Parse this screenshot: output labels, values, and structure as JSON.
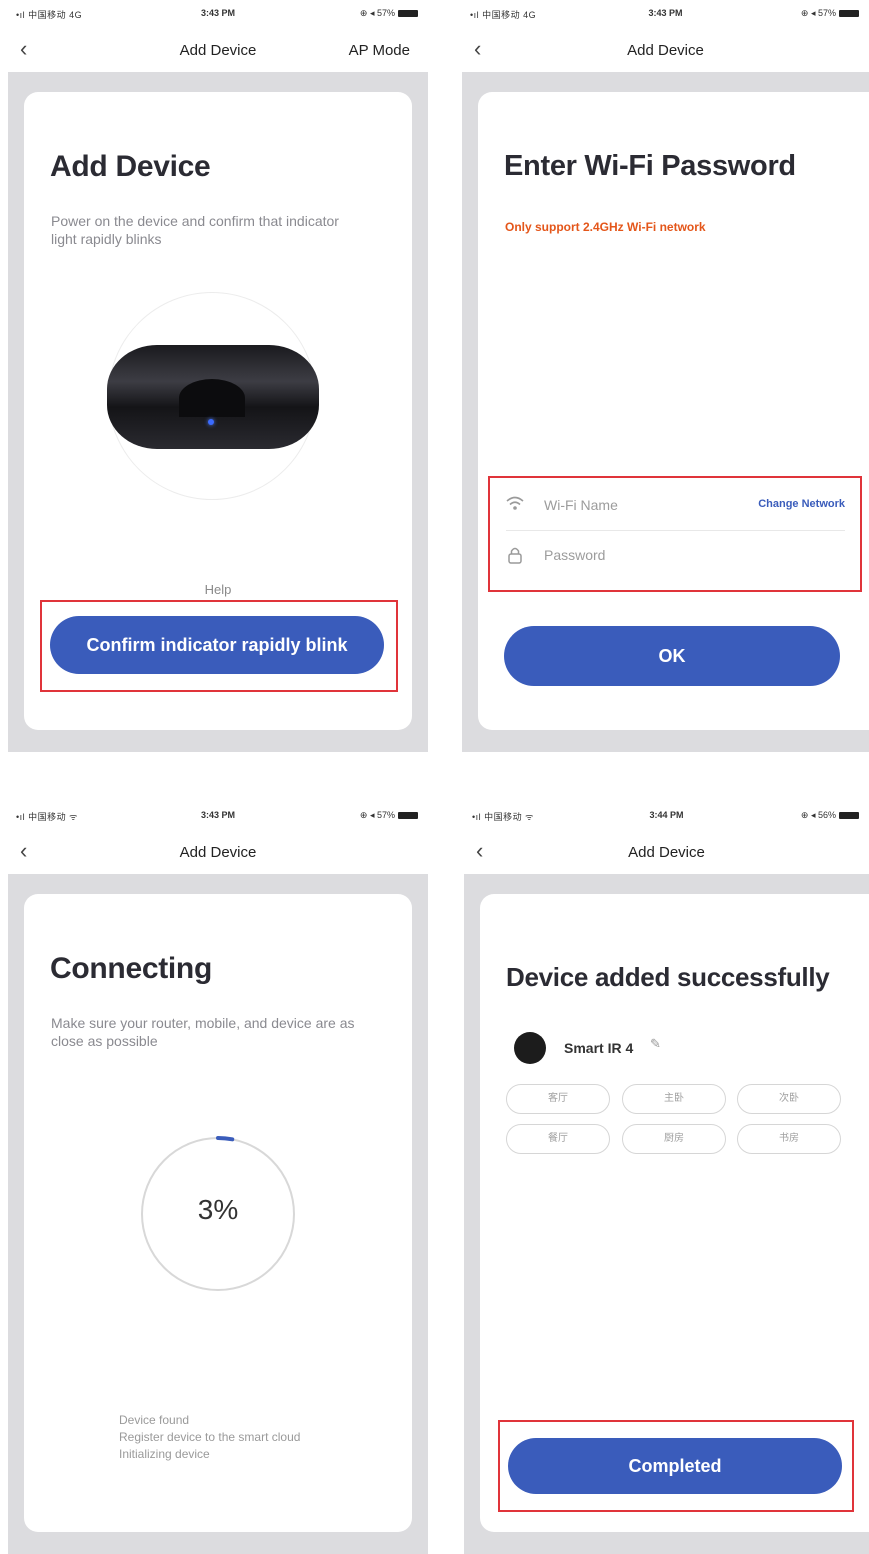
{
  "status_bars": [
    {
      "signal": "•ıl 中国移动 4G",
      "time": "3:43 PM",
      "battery": "⊕ ◂ 57%"
    },
    {
      "signal": "•ıl 中国移动 4G",
      "time": "3:43 PM",
      "battery": "⊕ ◂ 57%"
    },
    {
      "signal": "•ıl 中国移动 ᯤ",
      "time": "3:43 PM",
      "battery": "⊕ ◂ 57%"
    },
    {
      "signal": "•ıl 中国移动 ᯤ",
      "time": "3:44 PM",
      "battery": "⊕ ◂ 56%"
    }
  ],
  "nav": {
    "back": "‹",
    "title": "Add Device",
    "ap_mode": "AP Mode"
  },
  "screen1": {
    "heading": "Add Device",
    "subtitle": "Power on the device and confirm that indicator light rapidly blinks",
    "help": "Help",
    "confirm_button": "Confirm indicator rapidly blink"
  },
  "screen2": {
    "heading": "Enter Wi-Fi Password",
    "warning": "Only support 2.4GHz Wi-Fi network",
    "wifi_placeholder": "Wi-Fi Name",
    "change_network": "Change Network",
    "password_placeholder": "Password",
    "ok_button": "OK",
    "icons": {
      "wifi": "wifi-icon",
      "lock": "lock-icon"
    }
  },
  "screen3": {
    "heading": "Connecting",
    "subtitle": "Make sure your router, mobile, and device are as close as possible",
    "progress": 3,
    "progress_label": "3%",
    "steps": [
      "Device found",
      "Register device to the smart cloud",
      "Initializing device"
    ],
    "accent": "#3a5cbb"
  },
  "screen4": {
    "heading": "Device added successfully",
    "device_name": "Smart IR 4",
    "edit_icon": "✎",
    "rooms": [
      "客厅",
      "主卧",
      "次卧",
      "餐厅",
      "厨房",
      "书房"
    ],
    "completed_button": "Completed"
  },
  "colors": {
    "primary": "#3a5cbb",
    "warning": "#e4561a",
    "highlight_box": "#e0343a",
    "panel_bg": "#dcdcdf"
  }
}
